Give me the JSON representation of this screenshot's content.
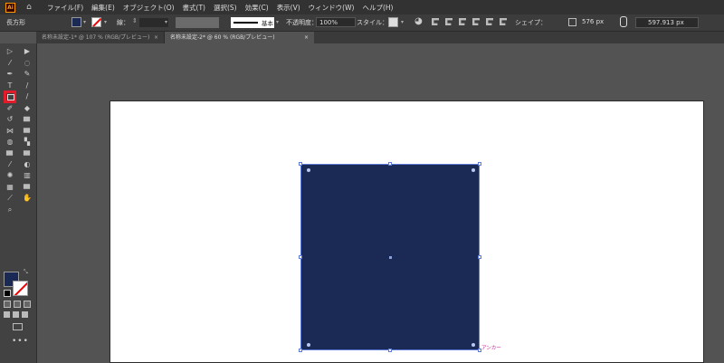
{
  "app": {
    "logo_text": "Ai",
    "home_icon": "home-icon"
  },
  "menu": [
    "ファイル(F)",
    "編集(E)",
    "オブジェクト(O)",
    "書式(T)",
    "選択(S)",
    "効果(C)",
    "表示(V)",
    "ウィンドウ(W)",
    "ヘルプ(H)"
  ],
  "control": {
    "tool_name": "長方形",
    "fill_color": "#1b2a55",
    "stroke_label": "線：",
    "stroke_profile": "基本",
    "opacity_label": "不透明度：",
    "opacity": "100%",
    "style_label": "スタイル：",
    "shape_label": "シェイプ：",
    "width": "576 px",
    "height": "597.913 px"
  },
  "tabs": [
    {
      "label": "名称未設定-1* @ 107 % (RGB/プレビュー)",
      "close": "×"
    },
    {
      "label": "名称未設定-2* @ 60 % (RGB/プレビュー)",
      "close": "×"
    }
  ],
  "canvas": {
    "rect_color": "#1b2a55",
    "anchor_hint": "アンカー"
  },
  "toolbox": {
    "selected_tool": "rectangle-tool",
    "more": "•••"
  }
}
